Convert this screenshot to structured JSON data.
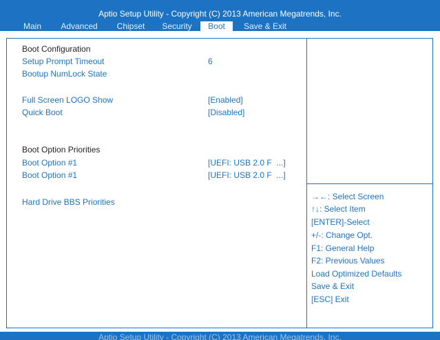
{
  "header": {
    "title": "Aptio Setup Utility - Copyright  (C)  2013 American Megatrends, Inc.",
    "tabs": [
      {
        "label": "Main"
      },
      {
        "label": "Advanced"
      },
      {
        "label": "Chipset"
      },
      {
        "label": "Security"
      },
      {
        "label": "Boot",
        "active": true
      },
      {
        "label": "Save & Exit"
      }
    ]
  },
  "main": {
    "boot_config_heading": "Boot Configuration",
    "setup_prompt_timeout": {
      "label": "Setup Prompt Timeout",
      "value": "6"
    },
    "bootup_numlock": {
      "label": "Bootup NumLock State",
      "value": ""
    },
    "full_screen_logo": {
      "label": "Full Screen LOGO Show",
      "value": "[Enabled]"
    },
    "quick_boot": {
      "label": "Quick Boot",
      "value": "[Disabled]"
    },
    "boot_option_priorities_heading": "Boot Option Priorities",
    "boot_option_1a": {
      "label": "Boot Option #1",
      "value": "[UEFI: USB 2.0 F  ...]"
    },
    "boot_option_1b": {
      "label": "Boot Option #1",
      "value": "[UEFI: USB 2.0 F  ...]"
    },
    "hard_drive_bbs": {
      "label": "Hard Drive BBS Priorities"
    }
  },
  "help": {
    "lines": [
      "→←: Select Screen",
      "↑↓: Select Item",
      "[ENTER]-Select",
      "+/-: Change Opt.",
      "F1: General Help",
      "F2: Previous Values",
      "Load Optimized Defaults",
      "Save & Exit",
      "[ESC] Exit"
    ]
  },
  "footer": {
    "text": "Aptio Setup Utility - Copyright  (C)  2013 American Megatrends, Inc."
  },
  "colors": {
    "accent": "#1d73c3",
    "background": "#ffffff",
    "heading_text": "#222222"
  }
}
